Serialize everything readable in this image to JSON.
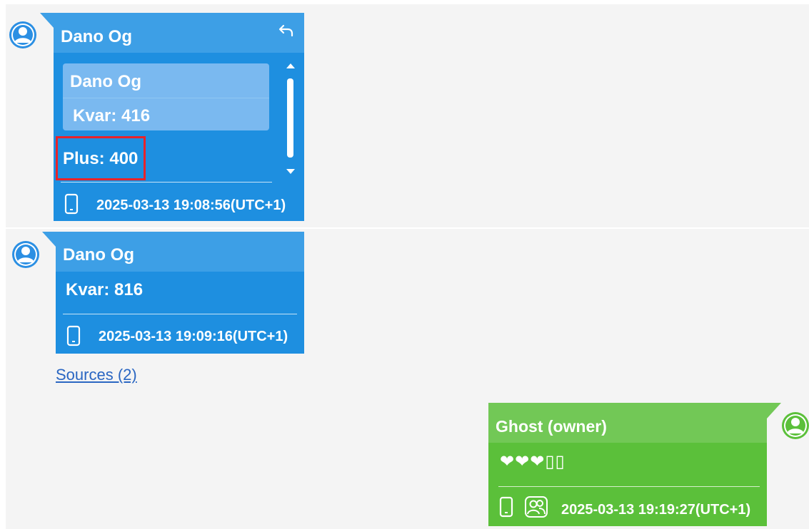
{
  "colors": {
    "background": "#f4f4f4",
    "bubble_blue": "#1e8fe0",
    "bubble_blue_header": "#3d9fe6",
    "bubble_green": "#5bc03a",
    "bubble_green_header": "#72c856",
    "highlight": "#e8232a",
    "link": "#2a66c2"
  },
  "messages": [
    {
      "sender": "Dano Og",
      "reply_icon": "reply-icon",
      "quote": {
        "sender": "Dano Og",
        "text": "Kvar: 416"
      },
      "text": "Plus: 400",
      "device_icon": "phone-icon",
      "timestamp": "2025-03-13 19:08:56(UTC+1)"
    },
    {
      "sender": "Dano Og",
      "text": "Kvar: 816",
      "device_icon": "phone-icon",
      "timestamp": "2025-03-13 19:09:16(UTC+1)"
    },
    {
      "sender": "Ghost (owner)",
      "text": "❤❤❤▯▯",
      "device_icon": "phone-icon",
      "secondary_icon": "contact-icon",
      "timestamp": "2025-03-13 19:19:27(UTC+1)"
    }
  ],
  "sources_link": "Sources (2)"
}
